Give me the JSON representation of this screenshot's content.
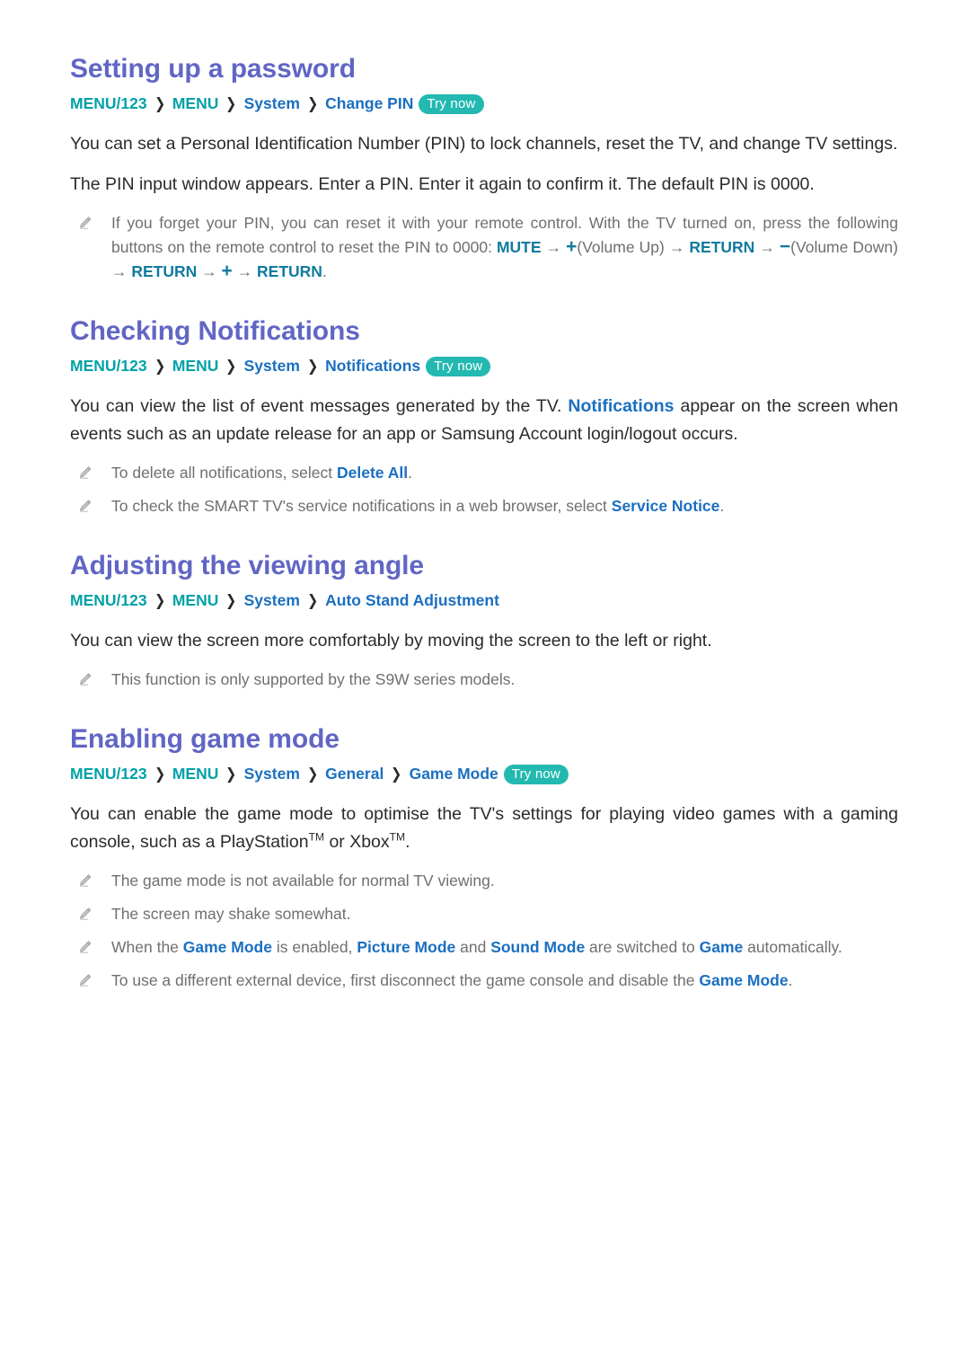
{
  "page": {
    "colors": {
      "heading": "#6166C4",
      "path_teal": "#00A1A7",
      "path_blue": "#1B6FC0",
      "badge_bg": "#23B9B0",
      "body_text": "#2B2B2B",
      "note_text": "#6F6F6F",
      "button_key": "#117A9E"
    },
    "badge_label": "Try now",
    "chevron": "❯",
    "pencil_icon": "pencil-icon"
  },
  "sections": [
    {
      "id": "setting-up-a-password",
      "title": "Setting up a password",
      "path": [
        {
          "label": "MENU/123",
          "color": "teal"
        },
        {
          "label": "MENU",
          "color": "teal"
        },
        {
          "label": "System",
          "color": "blue"
        },
        {
          "label": "Change PIN",
          "color": "blue"
        }
      ],
      "badge": "Try now",
      "paragraphs": [
        "You can set a Personal Identification Number (PIN) to lock channels, reset the TV, and change TV settings.",
        "The PIN input window appears. Enter a PIN. Enter it again to confirm it. The default PIN is 0000."
      ],
      "notes": [
        {
          "id": "reset-pin-note",
          "text": "If you forget your PIN, you can reset it with your remote control. With the TV turned on, press the following buttons on the remote control to reset the PIN to 0000: MUTE → +(Volume Up) → RETURN → −(Volume Down) → RETURN → + → RETURN.",
          "parts": [
            {
              "t": "If you forget your PIN, you can reset it with your remote control. With the TV turned on, press the following buttons on the remote control to reset the PIN to 0000: ",
              "s": "plain"
            },
            {
              "t": "MUTE",
              "s": "btnkey"
            },
            {
              "t": " → ",
              "s": "arrow"
            },
            {
              "t": "+",
              "s": "sym"
            },
            {
              "t": "(Volume Up) ",
              "s": "plain"
            },
            {
              "t": "→ ",
              "s": "arrow"
            },
            {
              "t": "RETURN",
              "s": "btnkey"
            },
            {
              "t": " → ",
              "s": "arrow"
            },
            {
              "t": "−",
              "s": "sym"
            },
            {
              "t": "(Volume Down) ",
              "s": "plain"
            },
            {
              "t": "→ ",
              "s": "arrow"
            },
            {
              "t": "RETURN",
              "s": "btnkey"
            },
            {
              "t": " → ",
              "s": "arrow"
            },
            {
              "t": "+",
              "s": "sym"
            },
            {
              "t": " → ",
              "s": "arrow"
            },
            {
              "t": "RETURN",
              "s": "btnkey"
            },
            {
              "t": ".",
              "s": "plain"
            }
          ]
        }
      ]
    },
    {
      "id": "checking-notifications",
      "title": "Checking Notifications",
      "path": [
        {
          "label": "MENU/123",
          "color": "teal"
        },
        {
          "label": "MENU",
          "color": "teal"
        },
        {
          "label": "System",
          "color": "blue"
        },
        {
          "label": "Notifications",
          "color": "blue"
        }
      ],
      "badge": "Try now",
      "paragraphs_rich": [
        [
          {
            "t": "You can view the list of event messages generated by the TV. ",
            "s": "plain"
          },
          {
            "t": "Notifications",
            "s": "blue"
          },
          {
            "t": " appear on the screen when events such as an update release for an app or Samsung Account login/logout occurs.",
            "s": "plain"
          }
        ]
      ],
      "notes": [
        {
          "id": "delete-all-note",
          "parts": [
            {
              "t": "To delete all notifications, select ",
              "s": "plain"
            },
            {
              "t": "Delete All",
              "s": "blue"
            },
            {
              "t": ".",
              "s": "plain"
            }
          ]
        },
        {
          "id": "service-notice-note",
          "parts": [
            {
              "t": "To check the SMART TV's service notifications in a web browser, select ",
              "s": "plain"
            },
            {
              "t": "Service Notice",
              "s": "blue"
            },
            {
              "t": ".",
              "s": "plain"
            }
          ]
        }
      ]
    },
    {
      "id": "adjusting-the-viewing-angle",
      "title": "Adjusting the viewing angle",
      "path": [
        {
          "label": "MENU/123",
          "color": "teal"
        },
        {
          "label": "MENU",
          "color": "teal"
        },
        {
          "label": "System",
          "color": "blue"
        },
        {
          "label": "Auto Stand Adjustment",
          "color": "blue"
        }
      ],
      "badge": null,
      "paragraphs": [
        "You can view the screen more comfortably by moving the screen to the left or right."
      ],
      "notes": [
        {
          "id": "s9w-series-note",
          "parts": [
            {
              "t": "This function is only supported by the S9W series models.",
              "s": "plain"
            }
          ]
        }
      ]
    },
    {
      "id": "enabling-game-mode",
      "title": "Enabling game mode",
      "path": [
        {
          "label": "MENU/123",
          "color": "teal"
        },
        {
          "label": "MENU",
          "color": "teal"
        },
        {
          "label": "System",
          "color": "blue"
        },
        {
          "label": "General",
          "color": "blue"
        },
        {
          "label": "Game Mode",
          "color": "blue"
        }
      ],
      "badge": "Try now",
      "paragraphs_rich": [
        [
          {
            "t": "You can enable the game mode to optimise the TV's settings for playing video games with a gaming console, such as a PlayStation",
            "s": "plain"
          },
          {
            "t": "TM",
            "s": "tm"
          },
          {
            "t": " or Xbox",
            "s": "plain"
          },
          {
            "t": "TM",
            "s": "tm"
          },
          {
            "t": ".",
            "s": "plain"
          }
        ]
      ],
      "notes": [
        {
          "id": "not-available-normal-tv-note",
          "parts": [
            {
              "t": "The game mode is not available for normal TV viewing.",
              "s": "plain"
            }
          ]
        },
        {
          "id": "screen-shake-note",
          "parts": [
            {
              "t": "The screen may shake somewhat.",
              "s": "plain"
            }
          ]
        },
        {
          "id": "picture-sound-mode-note",
          "parts": [
            {
              "t": "When the ",
              "s": "plain"
            },
            {
              "t": "Game Mode",
              "s": "blue"
            },
            {
              "t": " is enabled, ",
              "s": "plain"
            },
            {
              "t": "Picture Mode",
              "s": "blue"
            },
            {
              "t": " and ",
              "s": "plain"
            },
            {
              "t": "Sound Mode",
              "s": "blue"
            },
            {
              "t": " are switched to ",
              "s": "plain"
            },
            {
              "t": "Game",
              "s": "blue"
            },
            {
              "t": " automatically.",
              "s": "plain"
            }
          ]
        },
        {
          "id": "external-device-note",
          "parts": [
            {
              "t": "To use a different external device, first disconnect the game console and disable the ",
              "s": "plain"
            },
            {
              "t": "Game Mode",
              "s": "blue"
            },
            {
              "t": ".",
              "s": "plain"
            }
          ]
        }
      ]
    }
  ]
}
